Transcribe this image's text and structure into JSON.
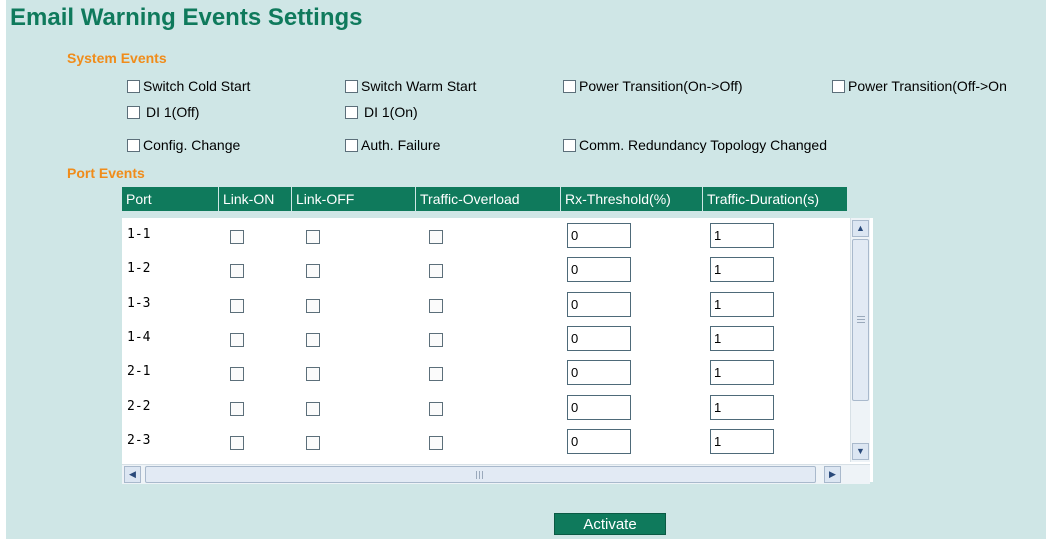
{
  "page_title": "Email Warning Events Settings",
  "system_events": {
    "title": "System Events",
    "items": [
      {
        "label": "Switch Cold Start",
        "checked": false
      },
      {
        "label": "Switch Warm Start",
        "checked": false
      },
      {
        "label": "Power Transition(On->Off)",
        "checked": false
      },
      {
        "label": "Power Transition(Off->On",
        "checked": false
      },
      {
        "label": "DI 1(Off)",
        "checked": false
      },
      {
        "label": "DI 1(On)",
        "checked": false
      },
      {
        "label": "Config. Change",
        "checked": false
      },
      {
        "label": "Auth. Failure",
        "checked": false
      },
      {
        "label": "Comm. Redundancy Topology Changed",
        "checked": false
      }
    ]
  },
  "port_events": {
    "title": "Port Events",
    "columns": [
      "Port",
      "Link-ON",
      "Link-OFF",
      "Traffic-Overload",
      "Rx-Threshold(%)",
      "Traffic-Duration(s)"
    ],
    "rows": [
      {
        "port": "1-1",
        "rx_threshold": "0",
        "traffic_duration": "1"
      },
      {
        "port": "1-2",
        "rx_threshold": "0",
        "traffic_duration": "1"
      },
      {
        "port": "1-3",
        "rx_threshold": "0",
        "traffic_duration": "1"
      },
      {
        "port": "1-4",
        "rx_threshold": "0",
        "traffic_duration": "1"
      },
      {
        "port": "2-1",
        "rx_threshold": "0",
        "traffic_duration": "1"
      },
      {
        "port": "2-2",
        "rx_threshold": "0",
        "traffic_duration": "1"
      },
      {
        "port": "2-3",
        "rx_threshold": "0",
        "traffic_duration": "1"
      }
    ]
  },
  "activate_label": "Activate",
  "colors": {
    "background": "#cfe6e6",
    "title": "#0f7a5c",
    "section": "#f08c1a",
    "table_header": "#0f7a5c"
  }
}
